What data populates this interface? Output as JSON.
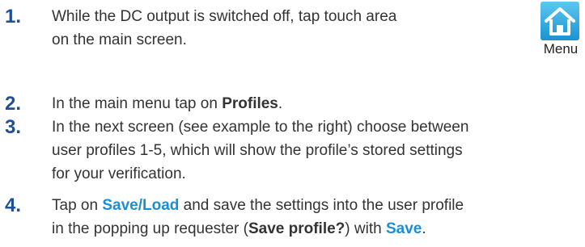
{
  "steps": [
    {
      "number": "1.",
      "line1": "While the DC output is switched off, tap touch area",
      "line2": "on the main screen."
    },
    {
      "number": "2.",
      "before": "In the main menu tap on ",
      "bold": "Profiles",
      "after": "."
    },
    {
      "number": "3.",
      "line1": "In the next screen (see example to the right) choose between",
      "line2": "user profiles 1-5, which will show the profile’s stored settings",
      "line3": "for your verification."
    },
    {
      "number": "4.",
      "l1_before": "Tap on ",
      "l1_link": "Save/Load",
      "l1_after": " and save the settings into the user profile",
      "l2_before": "in the popping up requester (",
      "l2_bold": "Save profile?",
      "l2_mid": ") with ",
      "l2_link": "Save",
      "l2_after": "."
    }
  ],
  "menu_button": {
    "icon": "home-icon",
    "label": "Menu"
  },
  "colors": {
    "number": "#1f4e9a",
    "link": "#1a8fd6",
    "text": "#333333",
    "icon_bg": "#29aae1"
  }
}
